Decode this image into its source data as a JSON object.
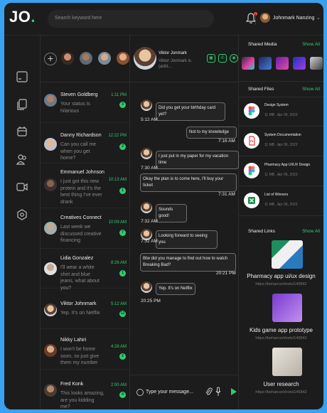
{
  "app": {
    "logo": "JO",
    "logo_dot": "."
  },
  "search": {
    "placeholder": "Search keyword here"
  },
  "user": {
    "name": "Johnmark Nanzing"
  },
  "contacts": [
    {
      "name": "Steven Goldberg",
      "message": "Your status is hilarious",
      "time": "1:11 PM",
      "unread": "3"
    },
    {
      "name": "Danny Richardson",
      "message": "Can you call me when you get home?",
      "time": "12:22 PM",
      "unread": "2"
    },
    {
      "name": "Emmanuel Johnson",
      "message": "I just got this new protein and it's the best thing I've ever drank",
      "time": "10:13 AM",
      "unread": "1"
    },
    {
      "name": "Creatives Connect",
      "message": "Last week we discussed creative financing",
      "time": "10:09 AM",
      "unread": "7"
    },
    {
      "name": "Lidia Gonzalez",
      "message": "I'll wear a white shirt and blue jeans, what about you?",
      "time": "8:26 AM",
      "unread": "1"
    },
    {
      "name": "Viktor Johnmark",
      "message": "Yep. It's on Netflix",
      "time": "5:12 AM",
      "unread": "12"
    },
    {
      "name": "Nikky Lahiri",
      "message": "I won't be home soon, so just give them my number",
      "time": "4:28 AM",
      "unread": "2"
    },
    {
      "name": "Fred Konk",
      "message": "This looks amazing, are you kidding me?",
      "time": "2:00 AM",
      "unread": "4"
    }
  ],
  "chat": {
    "name": "Viktor Jonmark",
    "subtitle": "Viktor Jonmark is (artiil...",
    "messages": [
      {
        "from": "them",
        "text": "Did you get your birthday card yet?",
        "time": "5:12 AM"
      },
      {
        "from": "me",
        "text": "Not to my knowledge",
        "time": "7:16 AM"
      },
      {
        "from": "them",
        "text": "I just put in my paper for my vacation time",
        "time": "7:30 AM"
      },
      {
        "from": "me",
        "text": "Okay the plan is to come here, I'll buy your ticket",
        "time": "7:31 AM"
      },
      {
        "from": "them",
        "text": "Sounds good!",
        "time": "7:32 AM"
      },
      {
        "from": "them",
        "text": "Looking forward to seeing you",
        "time": "7:32 AM"
      },
      {
        "from": "me",
        "text": "Btw did you manage to find out how to watch Breaking Bad?",
        "time": "20:21 PM"
      },
      {
        "from": "them",
        "text": "Yep. It's on Netflix",
        "time": "20:25 PM"
      }
    ],
    "composer_placeholder": "Type your message..."
  },
  "shared_media": {
    "title": "Shared Media",
    "show_all": "Show All"
  },
  "shared_files": {
    "title": "Shared Files",
    "show_all": "Show All",
    "files": [
      {
        "name": "Design System",
        "meta": "11 MB . Apr 06, 2022",
        "icon": "figma-icon"
      },
      {
        "name": "System Documentation",
        "meta": "11 MB . Apr 06, 2022",
        "icon": "pdf-icon"
      },
      {
        "name": "Pharmacy App UI/UX Design",
        "meta": "11 MB . Apr 06, 2022",
        "icon": "figma-icon"
      },
      {
        "name": "List of Winners",
        "meta": "11 MB . Apr 06, 2022",
        "icon": "excel-icon"
      }
    ]
  },
  "shared_links": {
    "title": "Shared Links",
    "show_all": "Show All",
    "links": [
      {
        "title": "Pharmacy app ui/ux design",
        "url": "https://behance/shots/145842"
      },
      {
        "title": "Kids game app prototype",
        "url": "https://behance/shots/145842"
      },
      {
        "title": "User research",
        "url": "https://behance/shots/145842"
      }
    ]
  },
  "colors": {
    "accent": "#2ecc71",
    "background": "#1c1c1c",
    "frame": "#3aa1f0",
    "alert": "#e74c3c"
  }
}
